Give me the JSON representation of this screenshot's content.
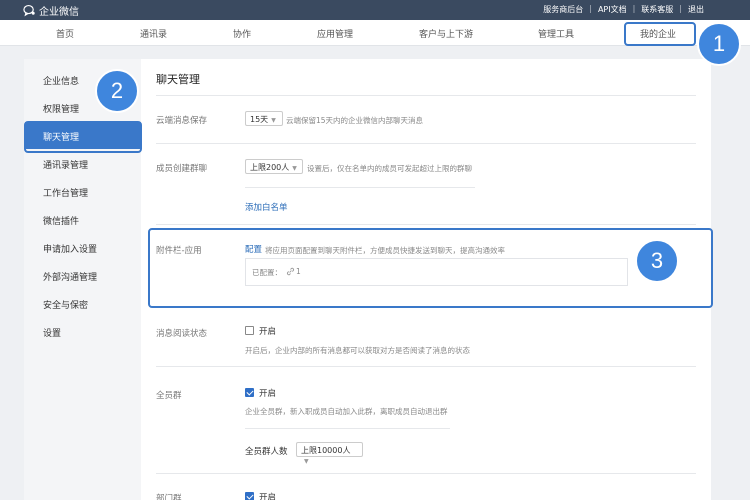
{
  "topbar": {
    "brand": "企业微信",
    "links": [
      "服务商后台",
      "API文档",
      "联系客服",
      "退出"
    ]
  },
  "nav": [
    "首页",
    "通讯录",
    "协作",
    "应用管理",
    "客户与上下游",
    "管理工具",
    "我的企业"
  ],
  "sidebar": [
    "企业信息",
    "权限管理",
    "聊天管理",
    "通讯录管理",
    "工作台管理",
    "微信插件",
    "申请加入设置",
    "外部沟通管理",
    "安全与保密",
    "设置"
  ],
  "main": {
    "title": "聊天管理",
    "cloud": {
      "label": "云端消息保存",
      "value": "15天",
      "hint": "云端保留15天内的企业微信内部聊天消息"
    },
    "group": {
      "label": "成员创建群聊",
      "value": "上限200人",
      "hint": "设置后，仅在名单内的成员可发起超过上限的群聊",
      "link": "添加白名单"
    },
    "attach": {
      "label": "附件栏-应用",
      "link": "配置",
      "hint": "将应用页面配置到聊天附件栏，方便成员快捷发送到聊天，提高沟通效率",
      "configured": "已配置：",
      "count": "1"
    },
    "read": {
      "label": "消息阅读状态",
      "option": "开启",
      "hint": "开启后，企业内部的所有消息都可以获取对方是否阅读了消息的状态"
    },
    "allgroup": {
      "label": "全员群",
      "option": "开启",
      "hint": "企业全员群，新入职成员自动加入此群，离职成员自动退出群",
      "size_label": "全员群人数",
      "size_value": "上限10000人"
    },
    "dept": {
      "label": "部门群",
      "option": "开启"
    }
  },
  "badges": [
    "1",
    "2",
    "3"
  ],
  "colors": {
    "highlight": "#3a78c9",
    "badge": "#3f86dd",
    "topbar": "#3a4a60"
  }
}
